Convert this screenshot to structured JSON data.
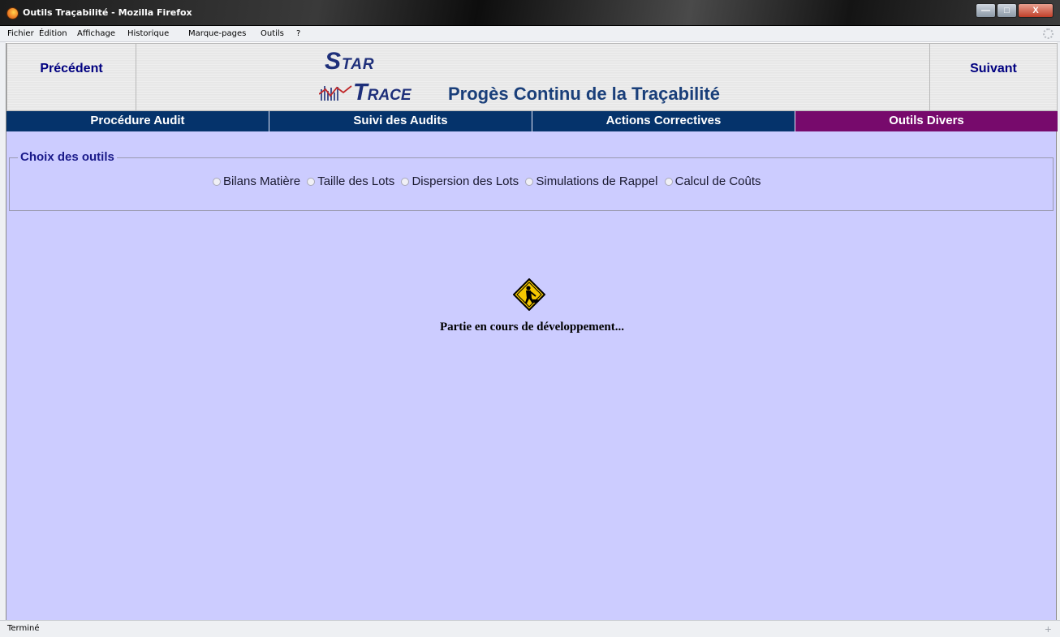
{
  "window": {
    "title": "Outils Traçabilité - Mozilla Firefox",
    "buttons": {
      "minimize": "—",
      "maximize": "□",
      "close": "X"
    }
  },
  "menu": {
    "items": [
      "Fichier",
      "Édition",
      "Affichage",
      "Historique",
      "Marque-pages",
      "Outils",
      "?"
    ]
  },
  "header": {
    "prev_label": "Précédent",
    "next_label": "Suivant",
    "logo_star_initial": "S",
    "logo_star_rest": "TAR",
    "logo_trace_initial": "T",
    "logo_trace_rest": "RACE",
    "slogan": "Progès Continu de la Traçabilité"
  },
  "tabs": [
    {
      "label": "Procédure Audit",
      "active": false
    },
    {
      "label": "Suivi des Audits",
      "active": false
    },
    {
      "label": "Actions Correctives",
      "active": false
    },
    {
      "label": "Outils Divers",
      "active": true
    }
  ],
  "choice": {
    "legend": "Choix des outils",
    "options": [
      "Bilans Matière",
      "Taille des Lots",
      "Dispersion des Lots",
      "Simulations de Rappel",
      "Calcul de Coûts"
    ]
  },
  "notice": {
    "icon": "construction-sign-icon",
    "text": "Partie en cours de développement..."
  },
  "status": {
    "text": "Terminé"
  },
  "colors": {
    "page_background": "#ccccff",
    "tab_background": "#05336b",
    "tab_active": "#770a6c",
    "nav_text": "#000080"
  }
}
